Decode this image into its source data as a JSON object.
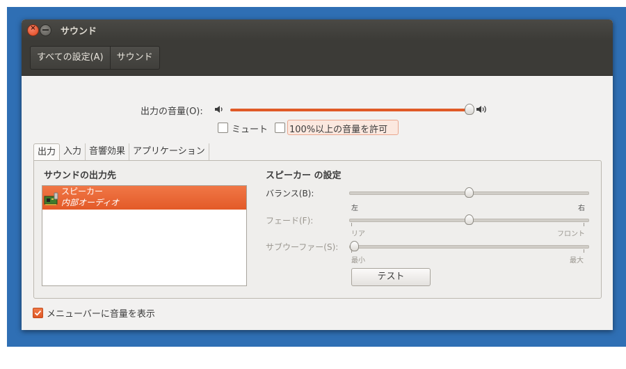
{
  "window": {
    "title": "サウンド"
  },
  "toolbar": {
    "breadcrumbs": [
      "すべての設定(A)",
      "サウンド"
    ]
  },
  "volume": {
    "label": "出力の音量(O):",
    "level": 1.0,
    "mute_label": "ミュート",
    "mute_checked": false,
    "amplify_label": "100%以上の音量を許可",
    "amplify_checked": false
  },
  "tabs": [
    "出力",
    "入力",
    "音響効果",
    "アプリケーション"
  ],
  "active_tab": "出力",
  "output": {
    "list_heading": "サウンドの出力先",
    "devices": [
      {
        "name": "スピーカー",
        "description": "内部オーディオ",
        "selected": true
      }
    ]
  },
  "settings": {
    "heading": "スピーカー の設定",
    "balance": {
      "label": "バランス(B):",
      "left": "左",
      "right": "右",
      "value": 0.5
    },
    "fade": {
      "label": "フェード(F):",
      "left": "リア",
      "right": "フロント",
      "value": 0.5
    },
    "subwoofer": {
      "label": "サブウーファー(S):",
      "left": "最小",
      "right": "最大",
      "value": 0.0
    },
    "test_label": "テスト"
  },
  "footer": {
    "menu_volume_label": "メニューバーに音量を表示",
    "menu_volume_checked": true
  },
  "colors": {
    "accent": "#e05a27",
    "titlebar": "#3c3b37",
    "desktop": "#2f6fb4",
    "window_bg": "#f2f1f0"
  }
}
